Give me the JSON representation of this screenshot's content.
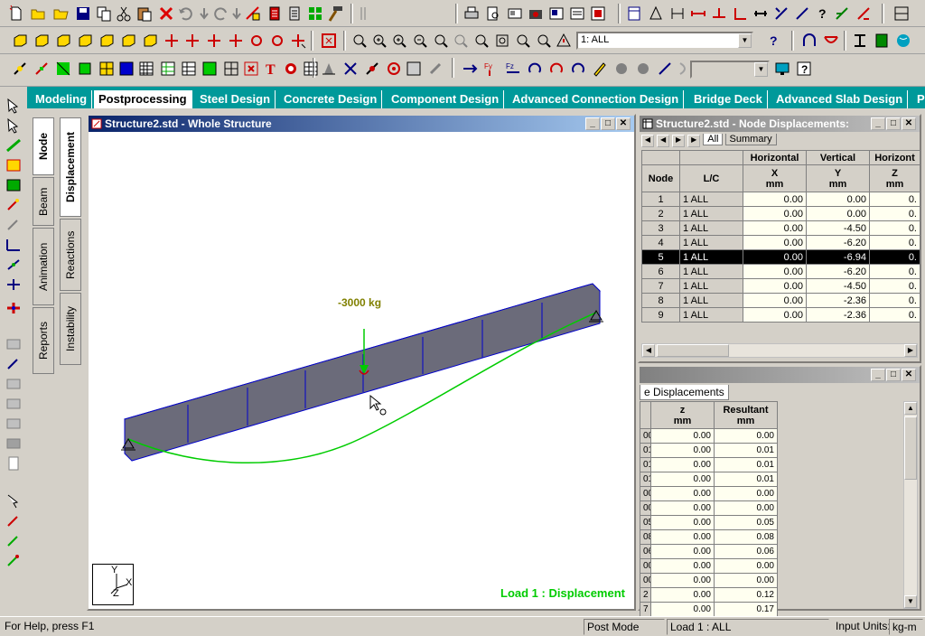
{
  "toolbar": {
    "row1_icons": [
      "new-file-icon",
      "open-icon",
      "open-folder-icon",
      "save-icon",
      "copy-icon",
      "cut-icon",
      "paste-icon",
      "delete-icon",
      "undo-icon",
      "redo-icon",
      "undo2-icon",
      "redo2-icon",
      "geometry-icon",
      "table-icon",
      "list-icon",
      "structure-wizard-icon",
      "hammer-icon",
      "print-icon",
      "print-preview-icon",
      "report-icon",
      "snapshot-icon",
      "picture-icon",
      "report-setup-icon",
      "toggle-icon",
      "frame-icon",
      "node-icon",
      "dimension-icon",
      "dimension2-icon",
      "dimension3-icon",
      "dimension4-icon",
      "dimension5-icon",
      "dimension6-icon",
      "help-icon",
      "dimension7-icon",
      "dimension8-icon",
      "view-tool-icon"
    ],
    "loadcase_combo": "1: ALL",
    "help_icon": "help-icon"
  },
  "page_tabs": [
    {
      "label": "Modeling"
    },
    {
      "label": "Postprocessing",
      "active": true
    },
    {
      "label": "Steel Design"
    },
    {
      "label": "Concrete Design"
    },
    {
      "label": "Component Design"
    },
    {
      "label": "Advanced Connection Design"
    },
    {
      "label": "Bridge Deck"
    },
    {
      "label": "Advanced Slab Design"
    },
    {
      "label": "P"
    }
  ],
  "vertical_tabs_left": [
    "Node",
    "Beam",
    "Animation",
    "Reports"
  ],
  "vertical_tabs_right": [
    "Displacement",
    "Reactions",
    "Instability"
  ],
  "main_window": {
    "title": "Structure2.std - Whole Structure",
    "load_label": "-3000 kg",
    "status_label": "Load 1 : Displacement",
    "axis_y": "Y",
    "axis_x": "X",
    "axis_z": "Z"
  },
  "table_window": {
    "title": "Structure2.std - Node Displacements:",
    "sheet_tabs": [
      "All",
      "Summary"
    ],
    "group_headers": [
      "Horizontal",
      "Vertical",
      "Horizont"
    ],
    "col_headers": [
      "Node",
      "L/C",
      "X\nmm",
      "Y\nmm",
      "Z\nmm"
    ],
    "col_node": "Node",
    "col_lc": "L/C",
    "col_x": "X",
    "col_y": "Y",
    "col_z": "Z",
    "unit": "mm",
    "rows": [
      {
        "node": "1",
        "lc": "1 ALL",
        "x": "0.00",
        "y": "0.00",
        "z": "0."
      },
      {
        "node": "2",
        "lc": "1 ALL",
        "x": "0.00",
        "y": "0.00",
        "z": "0."
      },
      {
        "node": "3",
        "lc": "1 ALL",
        "x": "0.00",
        "y": "-4.50",
        "z": "0."
      },
      {
        "node": "4",
        "lc": "1 ALL",
        "x": "0.00",
        "y": "-6.20",
        "z": "0."
      },
      {
        "node": "5",
        "lc": "1 ALL",
        "x": "0.00",
        "y": "-6.94",
        "z": "0.",
        "selected": true
      },
      {
        "node": "6",
        "lc": "1 ALL",
        "x": "0.00",
        "y": "-6.20",
        "z": "0."
      },
      {
        "node": "7",
        "lc": "1 ALL",
        "x": "0.00",
        "y": "-4.50",
        "z": "0."
      },
      {
        "node": "8",
        "lc": "1 ALL",
        "x": "0.00",
        "y": "-2.36",
        "z": "0."
      },
      {
        "node": "9",
        "lc": "1 ALL",
        "x": "0.00",
        "y": "-2.36",
        "z": "0."
      }
    ]
  },
  "summary_window": {
    "sheet_tab": "e Displacements",
    "col_z": "z",
    "col_resultant": "Resultant",
    "unit": "mm",
    "rows": [
      {
        "stub": "00",
        "z": "0.00",
        "r": "0.00"
      },
      {
        "stub": "01",
        "z": "0.00",
        "r": "0.01"
      },
      {
        "stub": "01",
        "z": "0.00",
        "r": "0.01"
      },
      {
        "stub": "01",
        "z": "0.00",
        "r": "0.01"
      },
      {
        "stub": "00",
        "z": "0.00",
        "r": "0.00"
      },
      {
        "stub": "00",
        "z": "0.00",
        "r": "0.00"
      },
      {
        "stub": "05",
        "z": "0.00",
        "r": "0.05"
      },
      {
        "stub": "08",
        "z": "0.00",
        "r": "0.08"
      },
      {
        "stub": "06",
        "z": "0.00",
        "r": "0.06"
      },
      {
        "stub": "00",
        "z": "0.00",
        "r": "0.00"
      },
      {
        "stub": "00",
        "z": "0.00",
        "r": "0.00"
      },
      {
        "stub": "2",
        "z": "0.00",
        "r": "0.12"
      },
      {
        "stub": "7",
        "z": "0.00",
        "r": "0.17"
      }
    ]
  },
  "status_bar": {
    "help": "For Help, press F1",
    "mode": "Post Mode",
    "load": "Load 1 : ALL",
    "units_label": "Input Units:",
    "units": "kg-m"
  },
  "colors": {
    "tab_bar": "#00999a",
    "title_active": "#0a246a",
    "beam_fill": "#6b6b7a",
    "beam_edge": "#0000cc",
    "deflection": "#00cc00",
    "load_text": "#808000",
    "status_green": "#00cc00"
  }
}
